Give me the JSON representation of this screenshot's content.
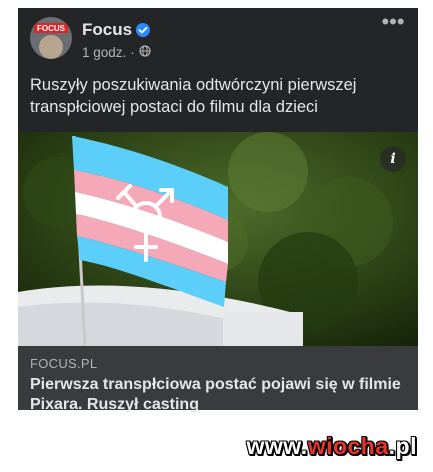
{
  "post": {
    "page_name": "Focus",
    "time": "1 godz.",
    "separator": "·",
    "text": "Ruszyły poszukiwania odtwórczyni pierwszej transpłciowej postaci do filmu dla dzieci",
    "avatar_label": "FOCUS",
    "more_label": "•••",
    "info_label": "i",
    "icons": {
      "verified": "verified-badge-icon",
      "audience": "globe-icon",
      "more": "more-options-icon",
      "info": "info-icon"
    }
  },
  "link": {
    "domain": "FOCUS.PL",
    "title": "Pierwsza transpłciowa postać pojawi się w filmie Pixara. Ruszył casting"
  },
  "watermark": {
    "prefix": "www.",
    "accent": "wiocha",
    "suffix": ".pl"
  },
  "colors": {
    "card_bg": "#242526",
    "link_bg": "#3a3b3c",
    "text_primary": "#e4e6eb",
    "text_secondary": "#b0b3b8",
    "verified_blue": "#2d88ff",
    "flag_blue": "#5bcefa",
    "flag_pink": "#f5a9b8",
    "flag_white": "#ffffff",
    "watermark_red": "#e8322e"
  }
}
